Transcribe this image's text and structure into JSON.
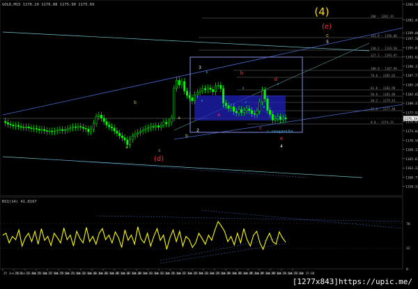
{
  "header": {
    "symbol_info": "GOLD,M15  1176.29 1176.88 1175.90 1175.69"
  },
  "watermark": "[1277x843]https://upic.me/",
  "rsi_header": "RSI(14) 41.0197",
  "colors": {
    "background": "#000000",
    "candle": "#00ff00",
    "rsi_line": "#ffff00",
    "channel": "#4a6cd6",
    "channel_outer": "#6fc8d0",
    "selection_box": "#7b86d6",
    "blue_zone": "#1f22c8",
    "wave_green": "#a8d85a",
    "wave_red": "#ff3333",
    "wave_white": "#ffffff",
    "wave_degree_yellow": "#ffdd00",
    "wave_cyan": "#33ccff",
    "fib_line": "#7a7a7a",
    "axis_text": "#c8c8c8"
  },
  "chart_data": [
    {
      "type": "candlestick",
      "title": "GOLD,M15",
      "y_ticks": [
        "1206.58",
        "1202.42",
        "1199.00",
        "1197.56",
        "1195.07",
        "1192.62",
        "1190.17",
        "1187.77",
        "1185.28",
        "1182.82",
        "1180.37",
        "1177.92",
        "1175.47",
        "1173.04",
        "1170.56",
        "1168.12",
        "1165.67",
        "1163.22",
        "1160.77",
        "1158.32",
        "1155.87"
      ],
      "current_price": "1176.34",
      "ylim": [
        1155.87,
        1206.58
      ],
      "close_series": [
        1175.6,
        1175.2,
        1174.8,
        1174.6,
        1174.3,
        1174.5,
        1174.2,
        1174.0,
        1173.9,
        1174.1,
        1173.8,
        1173.6,
        1173.7,
        1173.5,
        1173.2,
        1173.4,
        1173.1,
        1172.9,
        1173.0,
        1172.8,
        1173.0,
        1173.2,
        1173.4,
        1173.1,
        1173.3,
        1173.6,
        1173.8,
        1174.1,
        1173.9,
        1174.2,
        1174.0,
        1173.7,
        1173.5,
        1172.8,
        1173.5,
        1175.0,
        1176.8,
        1177.2,
        1176.4,
        1175.5,
        1174.6,
        1174.1,
        1173.8,
        1173.0,
        1172.4,
        1171.7,
        1171.2,
        1170.6,
        1169.4,
        1170.8,
        1171.6,
        1172.2,
        1172.6,
        1173.0,
        1173.3,
        1173.6,
        1173.8,
        1174.2,
        1174.0,
        1174.4,
        1174.0,
        1174.6,
        1175.3,
        1174.9,
        1175.4,
        1176.4,
        1184.3,
        1186.4,
        1185.2,
        1186.1,
        1183.6,
        1182.4,
        1181.8,
        1181.0,
        1182.6,
        1183.3,
        1183.7,
        1184.2,
        1183.9,
        1184.4,
        1184.0,
        1183.4,
        1184.9,
        1185.1,
        1184.2,
        1180.4,
        1179.7,
        1179.0,
        1179.4,
        1178.2,
        1177.8,
        1178.7,
        1177.9,
        1178.4,
        1178.9,
        1178.4,
        1177.6,
        1177.4,
        1178.3,
        1180.7,
        1183.8,
        1181.5,
        1178.5,
        1177.4,
        1175.9,
        1176.3,
        1176.8,
        1176.0,
        1176.5,
        1176.2
      ]
    },
    {
      "type": "line",
      "title": "RSI(14) 41.0197",
      "y_ticks": [
        "70",
        "32",
        "0"
      ],
      "ylim": [
        0,
        100
      ],
      "x_ticks": [
        "25 Jun 2015",
        "25 Jun 13:00",
        "25 Jun 15:00",
        "25 Jun 17:00",
        "25 Jun 19:00",
        "25 Jun 21:00",
        "25 Jun 23:00",
        "26 Jun 01:00",
        "26 Jun 03:00",
        "26 Jun 05:00",
        "26 Jun 07:00",
        "26 Jun 09:00",
        "26 Jun 11:00",
        "26 Jun 13:00",
        "26 Jun 15:00",
        "26 Jun 17:00",
        "26 Jun 19:00",
        "26 Jun 21:00",
        "26 Jun 23:00",
        "29 Jun 01:00",
        "29 Jun 03:00",
        "29 Jun 05:00",
        "29 Jun 07:00",
        "29 Jun 09:00",
        "29 Jun 11:00",
        "29 Jun 13:00",
        "29 Jun 15:00"
      ],
      "values": [
        52,
        55,
        40,
        50,
        45,
        60,
        35,
        48,
        55,
        42,
        58,
        38,
        62,
        44,
        50,
        36,
        55,
        48,
        40,
        63,
        45,
        52,
        35,
        58,
        47,
        40,
        64,
        42,
        50,
        38,
        55,
        62,
        45,
        52,
        40,
        57,
        48,
        33,
        60,
        44,
        52,
        38,
        65,
        46,
        40,
        55,
        35,
        50,
        62,
        44,
        52,
        30,
        48,
        60,
        42,
        58,
        35,
        50,
        45,
        33,
        40,
        55,
        47,
        38,
        52,
        44,
        60,
        73,
        66,
        58,
        42,
        50,
        37,
        55,
        40,
        62,
        45,
        35,
        52,
        58,
        40,
        30,
        45,
        55,
        42,
        38,
        57,
        48,
        41
      ]
    }
  ],
  "wave_labels": [
    {
      "text": "(4)",
      "color_key": "wave_degree_yellow"
    },
    {
      "text": "(e)",
      "color_key": "wave_red"
    },
    {
      "text": "c",
      "color_key": "wave_degree_yellow"
    },
    {
      "text": "5",
      "color_key": "wave_white"
    },
    {
      "text": "b",
      "color_key": "wave_green"
    },
    {
      "text": "a",
      "color_key": "wave_green"
    },
    {
      "text": "a",
      "color_key": "wave_green"
    },
    {
      "text": "b",
      "color_key": "wave_green"
    },
    {
      "text": "c",
      "color_key": "wave_green"
    },
    {
      "text": "(d)",
      "color_key": "wave_red"
    },
    {
      "text": "3",
      "color_key": "wave_white"
    },
    {
      "text": "2",
      "color_key": "wave_white"
    },
    {
      "text": "b",
      "color_key": "wave_red"
    },
    {
      "text": "a",
      "color_key": "wave_red"
    },
    {
      "text": "c",
      "color_key": "wave_red"
    },
    {
      "text": "d",
      "color_key": "wave_red"
    },
    {
      "text": "e",
      "color_key": "wave_red"
    },
    {
      "text": "4",
      "color_key": "wave_white"
    },
    {
      "text": "c - elongated flat",
      "color_key": "wave_cyan"
    },
    {
      "text": "a",
      "color_key": "wave_cyan"
    },
    {
      "text": "b",
      "color_key": "wave_cyan"
    },
    {
      "text": "c",
      "color_key": "wave_cyan"
    },
    {
      "text": "d",
      "color_key": "wave_cyan"
    },
    {
      "text": "e",
      "color_key": "wave_cyan"
    },
    {
      "text": "a",
      "color_key": "wave_cyan"
    },
    {
      "text": "b",
      "color_key": "wave_cyan"
    }
  ],
  "fib_labels": [
    "200 - 1202.19",
    "161.8 - 1196.80",
    "138.2 - 1193.50",
    "127.2 - 1191.97",
    "100.0 - 1187.99",
    "78.6 - 1185.03",
    "61.8 - 1182.98",
    "50.0 - 1181.06",
    "38.2 - 1179.43",
    "23.6 - 1177.40",
    "0.0 - 1174.13"
  ]
}
